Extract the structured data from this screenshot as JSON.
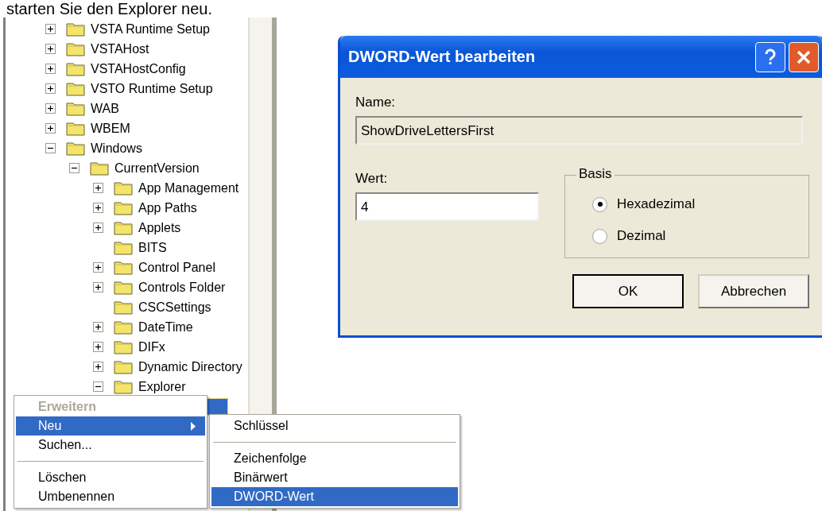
{
  "caption": "starten Sie den Explorer neu.",
  "tree": [
    {
      "label": "VSTA Runtime Setup",
      "expanded": false,
      "selected": false
    },
    {
      "label": "VSTAHost",
      "expanded": false,
      "selected": false
    },
    {
      "label": "VSTAHostConfig",
      "expanded": false,
      "selected": false
    },
    {
      "label": "VSTO Runtime Setup",
      "expanded": false,
      "selected": false
    },
    {
      "label": "WAB",
      "expanded": false,
      "selected": false
    },
    {
      "label": "WBEM",
      "expanded": false,
      "selected": false
    },
    {
      "label": "Windows",
      "expanded": true,
      "selected": false,
      "children": [
        {
          "label": "CurrentVersion",
          "expanded": true,
          "selected": false,
          "children": [
            {
              "label": "App Management",
              "expanded": false,
              "selected": false
            },
            {
              "label": "App Paths",
              "expanded": false,
              "selected": false
            },
            {
              "label": "Applets",
              "expanded": false,
              "selected": false
            },
            {
              "label": "BITS",
              "selected": false
            },
            {
              "label": "Control Panel",
              "expanded": false,
              "selected": false
            },
            {
              "label": "Controls Folder",
              "expanded": false,
              "selected": false
            },
            {
              "label": "CSCSettings",
              "selected": false
            },
            {
              "label": "DateTime",
              "expanded": false,
              "selected": false
            },
            {
              "label": "DIFx",
              "expanded": false,
              "selected": false
            },
            {
              "label": "Dynamic Directory",
              "expanded": false,
              "selected": false
            },
            {
              "label": "Explorer",
              "expanded": true,
              "selected": false,
              "children": [
                {
                  "selected": true
                }
              ]
            }
          ]
        }
      ]
    }
  ],
  "context_menu": [
    {
      "kind": "item",
      "label": "Erweitern",
      "disabled": true,
      "selected": false,
      "submenu": false
    },
    {
      "kind": "item",
      "label": "Neu",
      "disabled": false,
      "selected": true,
      "submenu": true
    },
    {
      "kind": "item",
      "label": "Suchen...",
      "disabled": false,
      "selected": false,
      "submenu": false
    },
    {
      "kind": "separator"
    },
    {
      "kind": "item",
      "label": "Löschen",
      "disabled": false,
      "selected": false,
      "submenu": false
    },
    {
      "kind": "item",
      "label": "Umbenennen",
      "disabled": false,
      "selected": false,
      "submenu": false
    }
  ],
  "submenu": [
    {
      "kind": "item",
      "label": "Schlüssel",
      "selected": false
    },
    {
      "kind": "separator"
    },
    {
      "kind": "item",
      "label": "Zeichenfolge",
      "selected": false
    },
    {
      "kind": "item",
      "label": "Binärwert",
      "selected": false
    },
    {
      "kind": "item",
      "label": "DWORD-Wert",
      "selected": true
    }
  ],
  "dialog": {
    "title": "DWORD-Wert bearbeiten",
    "name_label": "Name:",
    "name_value": "ShowDriveLettersFirst",
    "value_label": "Wert:",
    "value": "4",
    "base_group": {
      "legend": "Basis",
      "options": [
        {
          "label": "Hexadezimal",
          "selected": true
        },
        {
          "label": "Dezimal",
          "selected": false
        }
      ]
    },
    "buttons": [
      {
        "label": "OK",
        "default": true
      },
      {
        "label": "Abbrechen",
        "default": false
      }
    ]
  }
}
